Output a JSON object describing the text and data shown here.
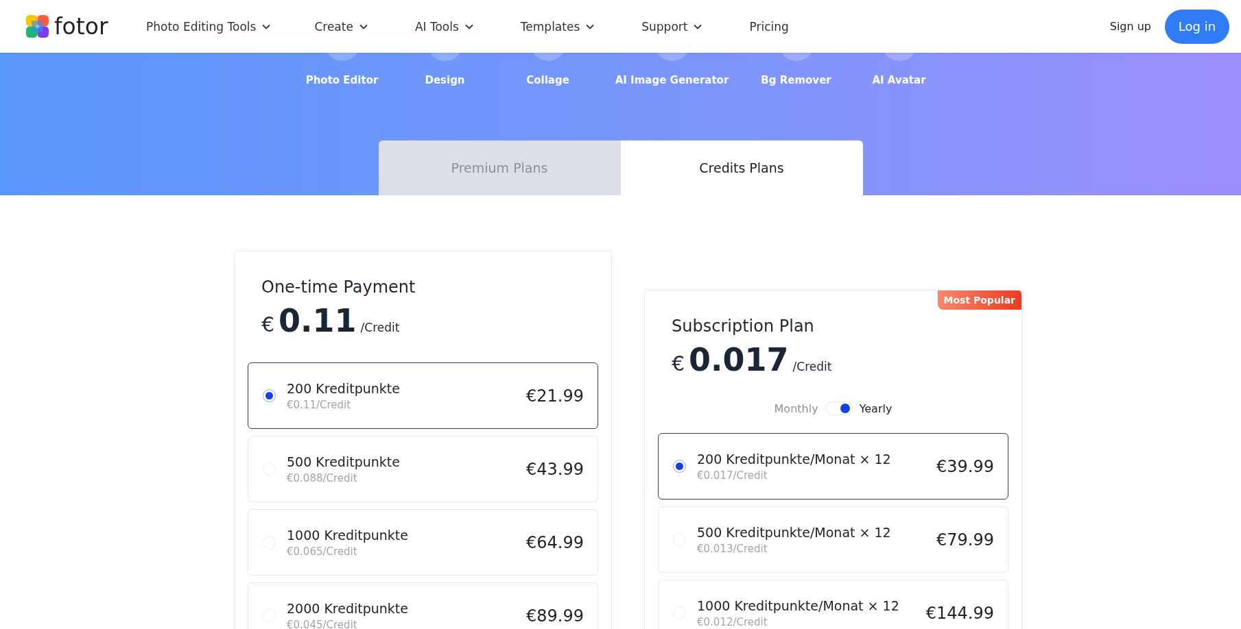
{
  "header": {
    "logo_text": "fotor",
    "nav": [
      {
        "label": "Photo Editing Tools",
        "dropdown": true
      },
      {
        "label": "Create",
        "dropdown": true
      },
      {
        "label": "AI Tools",
        "dropdown": true
      },
      {
        "label": "Templates",
        "dropdown": true
      },
      {
        "label": "Support",
        "dropdown": true
      },
      {
        "label": "Pricing",
        "dropdown": false
      }
    ],
    "sign_up": "Sign up",
    "log_in": "Log in"
  },
  "categories": [
    "Photo Editor",
    "Design",
    "Collage",
    "AI Image Generator",
    "Bg Remover",
    "AI Avatar"
  ],
  "plan_tabs": [
    {
      "label": "Premium Plans",
      "selected": false
    },
    {
      "label": "Credits Plans",
      "selected": true
    }
  ],
  "cards": [
    {
      "title": "One-time Payment",
      "currency": "€",
      "price": "0.11",
      "unit": "/Credit",
      "options": [
        {
          "name": "200 Kreditpunkte",
          "rate": "€0.11/Credit",
          "price": "€21.99",
          "selected": true
        },
        {
          "name": "500 Kreditpunkte",
          "rate": "€0.088/Credit",
          "price": "€43.99",
          "selected": false
        },
        {
          "name": "1000 Kreditpunkte",
          "rate": "€0.065/Credit",
          "price": "€64.99",
          "selected": false
        },
        {
          "name": "2000 Kreditpunkte",
          "rate": "€0.045/Credit",
          "price": "€89.99",
          "selected": false
        }
      ]
    },
    {
      "title": "Subscription Plan",
      "currency": "€",
      "price": "0.017",
      "unit": "/Credit",
      "badge": "Most Popular",
      "billing": {
        "monthly_label": "Monthly",
        "yearly_label": "Yearly",
        "yearly": true
      },
      "options": [
        {
          "name": "200 Kreditpunkte/Monat × 12",
          "rate": "€0.017/Credit",
          "price": "€39.99",
          "selected": true
        },
        {
          "name": "500 Kreditpunkte/Monat × 12",
          "rate": "€0.013/Credit",
          "price": "€79.99",
          "selected": false
        },
        {
          "name": "1000 Kreditpunkte/Monat × 12",
          "rate": "€0.012/Credit",
          "price": "€144.99",
          "selected": false
        }
      ]
    }
  ]
}
